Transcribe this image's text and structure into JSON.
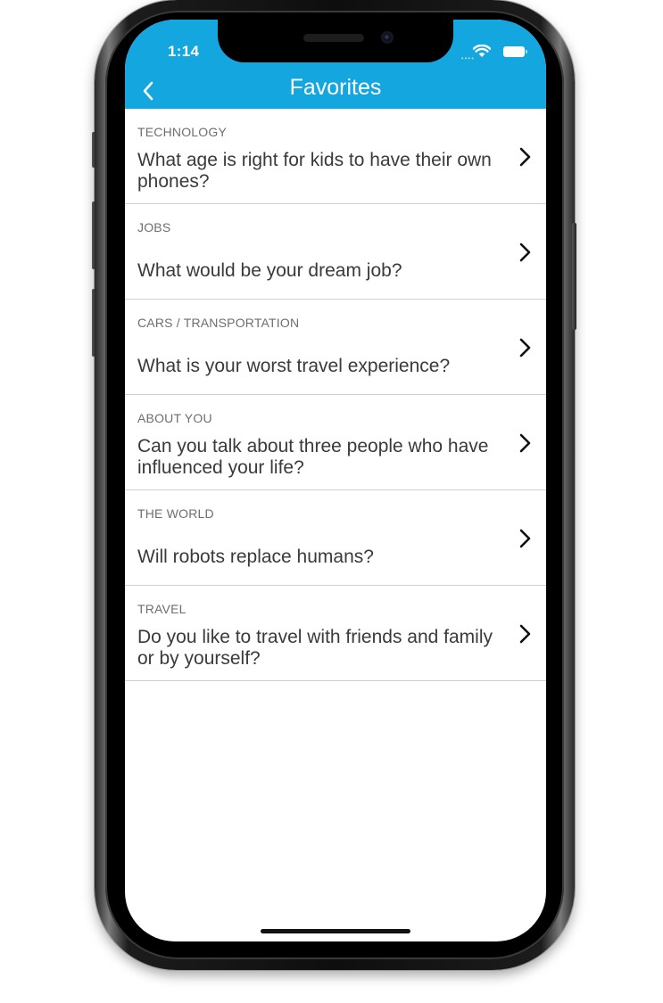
{
  "status_bar": {
    "time": "1:14"
  },
  "header": {
    "title": "Favorites",
    "back_icon": "chevron-left-icon"
  },
  "colors": {
    "header_bg": "#14a6df",
    "category_text": "#6e6e6e",
    "question_text": "#3a3a3a",
    "divider": "#cfcfcf"
  },
  "favorites": [
    {
      "category": "TECHNOLOGY",
      "question": "What age is right for kids to have their own phones?"
    },
    {
      "category": "JOBS",
      "question": "What would be your dream job?"
    },
    {
      "category": "CARS / TRANSPORTATION",
      "question": "What is your worst travel experience?"
    },
    {
      "category": "ABOUT YOU",
      "question": "Can you talk about three people who have influenced your life?"
    },
    {
      "category": "THE WORLD",
      "question": "Will robots replace humans?"
    },
    {
      "category": "TRAVEL",
      "question": "Do you like to travel with friends and family or by yourself?"
    }
  ]
}
